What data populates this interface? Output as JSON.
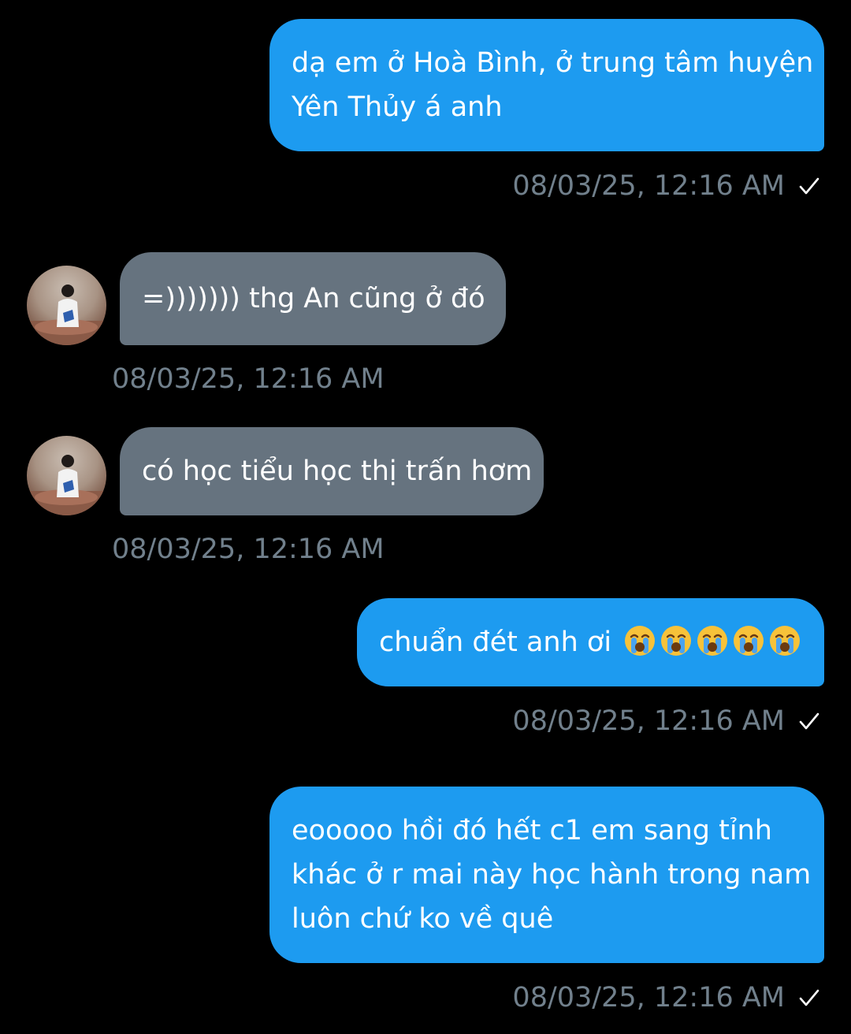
{
  "messages": [
    {
      "direction": "out",
      "lines": [
        "dạ em ở Hoà Bình, ở trung tâm huyện",
        "Yên Thủy á anh"
      ],
      "timestamp": "08/03/25, 12:16 AM",
      "status_icon": "check-icon"
    },
    {
      "direction": "in",
      "lines": [
        "=))))))) thg An cũng ở đó"
      ],
      "timestamp": "08/03/25, 12:16 AM",
      "avatar": "avatar"
    },
    {
      "direction": "in",
      "lines": [
        "có học tiểu học thị trấn hơm"
      ],
      "timestamp": "08/03/25, 12:16 AM",
      "avatar": "avatar"
    },
    {
      "direction": "out",
      "lines": [
        "chuẩn đét anh ơi"
      ],
      "emoji": [
        "loudly-crying-face-emoji",
        "loudly-crying-face-emoji",
        "loudly-crying-face-emoji",
        "loudly-crying-face-emoji",
        "loudly-crying-face-emoji"
      ],
      "timestamp": "08/03/25, 12:16 AM",
      "status_icon": "check-icon"
    },
    {
      "direction": "out",
      "lines": [
        "eooooo hồi đó hết c1 em sang tỉnh",
        "khác ở r mai này học hành trong nam",
        "luôn chứ ko về quê"
      ],
      "timestamp": "08/03/25, 12:16 AM",
      "status_icon": "check-icon"
    }
  ],
  "colors": {
    "background": "#000000",
    "outgoing_bubble": "#1d9bf0",
    "incoming_bubble": "#66737f",
    "timestamp_text": "#71808c",
    "message_text": "#ffffff"
  }
}
